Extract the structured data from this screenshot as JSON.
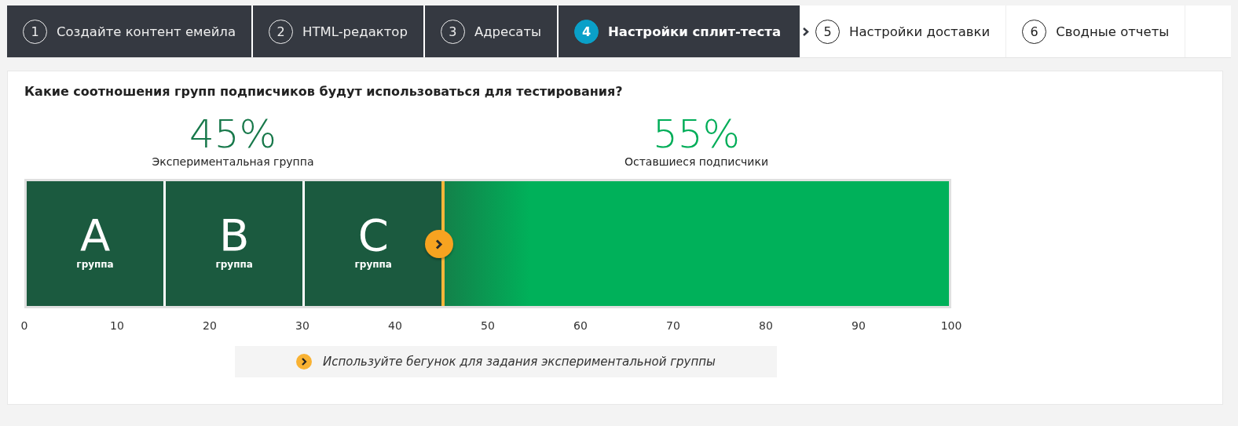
{
  "steps": [
    {
      "number": "1",
      "label": "Создайте контент емейла",
      "completed": true,
      "selected": false
    },
    {
      "number": "2",
      "label": "HTML-редактор",
      "completed": true,
      "selected": false
    },
    {
      "number": "3",
      "label": "Адресаты",
      "completed": true,
      "selected": false
    },
    {
      "number": "4",
      "label": "Настройки сплит-теста",
      "completed": true,
      "selected": true
    },
    {
      "number": "5",
      "label": "Настройки доставки",
      "completed": false,
      "selected": false
    },
    {
      "number": "6",
      "label": "Сводные отчеты",
      "completed": false,
      "selected": false
    }
  ],
  "split": {
    "question": "Какие соотношения групп подписчиков будут использоваться для тестирования?",
    "test_percent": "45%",
    "test_label": "Экспериментальная группа",
    "rest_percent": "55%",
    "rest_label": "Оставшиеся подписчики",
    "level": 0.45,
    "groups": [
      {
        "letter": "A",
        "label": "группа"
      },
      {
        "letter": "B",
        "label": "группа"
      },
      {
        "letter": "C",
        "label": "группа"
      }
    ],
    "ticks": [
      "0",
      "10",
      "20",
      "30",
      "40",
      "50",
      "60",
      "70",
      "80",
      "90",
      "100"
    ],
    "hint": "Используйте бегунок для задания экспериментальной группы"
  }
}
